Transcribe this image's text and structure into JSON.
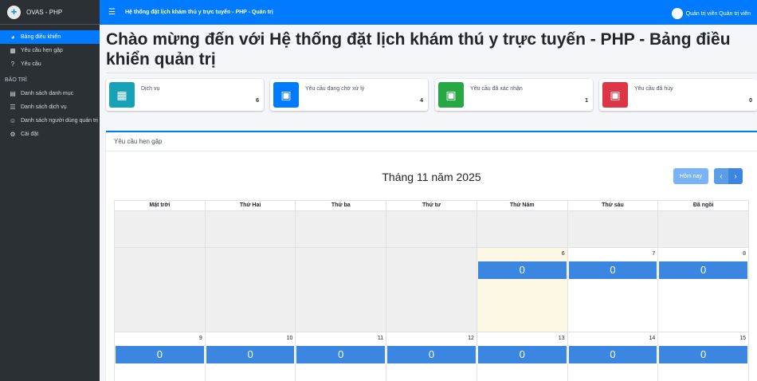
{
  "brand": {
    "name": "OVAS - PHP"
  },
  "sidebar": {
    "items": [
      {
        "label": "Bảng điều khiển",
        "icon": "dashboard-icon",
        "active": true
      },
      {
        "label": "Yêu cầu hẹn gặp",
        "icon": "calendar-icon",
        "active": false
      },
      {
        "label": "Yêu cầu",
        "icon": "question-circle-icon",
        "active": false
      }
    ],
    "section_header": "BẢO TRÌ",
    "maintenance_items": [
      {
        "label": "Danh sách danh mục",
        "icon": "table-icon"
      },
      {
        "label": "Danh sách dịch vụ",
        "icon": "list-icon"
      },
      {
        "label": "Danh sách người dùng quản trị",
        "icon": "users-icon"
      },
      {
        "label": "Cài đặt",
        "icon": "cogs-icon"
      }
    ]
  },
  "topbar": {
    "title": "Hệ thống đặt lịch khám thú y trực tuyến - PHP - Quản trị",
    "user_label": "Quản trị viên Quản trị viên"
  },
  "page": {
    "title": "Chào mừng đến với Hệ thống đặt lịch khám thú y trực tuyến - PHP - Bảng điều khiển quản trị"
  },
  "info_boxes": [
    {
      "label": "Dịch vụ",
      "count": "6",
      "color": "#17a2b8",
      "icon": "table-icon"
    },
    {
      "label": "Yêu cầu đang chờ xử lý",
      "count": "4",
      "color": "#007bff",
      "icon": "calendar-icon"
    },
    {
      "label": "Yêu cầu đã xác nhận",
      "count": "1",
      "color": "#28a745",
      "icon": "calendar-check-icon"
    },
    {
      "label": "Yêu cầu đã hủy",
      "count": "0",
      "color": "#dc3545",
      "icon": "calendar-times-icon"
    }
  ],
  "calendar": {
    "card_title": "Yêu cầu hẹn gặp",
    "month_title": "Tháng 11 năm 2025",
    "today_label": "Hôm nay",
    "prev_label": "‹",
    "next_label": "›",
    "days_of_week": [
      "Mặt trời",
      "Thứ Hai",
      "Thứ ba",
      "Thứ tư",
      "Thứ Năm",
      "Thứ sáu",
      "Đã ngồi"
    ],
    "weeks": [
      [
        {
          "n": "",
          "o": true
        },
        {
          "n": "",
          "o": true
        },
        {
          "n": "",
          "o": true
        },
        {
          "n": "",
          "o": true
        },
        {
          "n": "",
          "o": true
        },
        {
          "n": "",
          "o": true
        },
        {
          "n": "",
          "o": true
        }
      ],
      [
        {
          "n": "",
          "o": true
        },
        {
          "n": "",
          "o": true
        },
        {
          "n": "",
          "o": true
        },
        {
          "n": "",
          "o": true
        },
        {
          "n": "6",
          "e": "0",
          "t": true
        },
        {
          "n": "7",
          "e": "0"
        },
        {
          "n": "8",
          "e": "0"
        }
      ],
      [
        {
          "n": "9",
          "e": "0"
        },
        {
          "n": "10",
          "e": "0"
        },
        {
          "n": "11",
          "e": "0"
        },
        {
          "n": "12",
          "e": "0"
        },
        {
          "n": "13",
          "e": "0"
        },
        {
          "n": "14",
          "e": "0"
        },
        {
          "n": "15",
          "e": "0"
        }
      ]
    ]
  }
}
